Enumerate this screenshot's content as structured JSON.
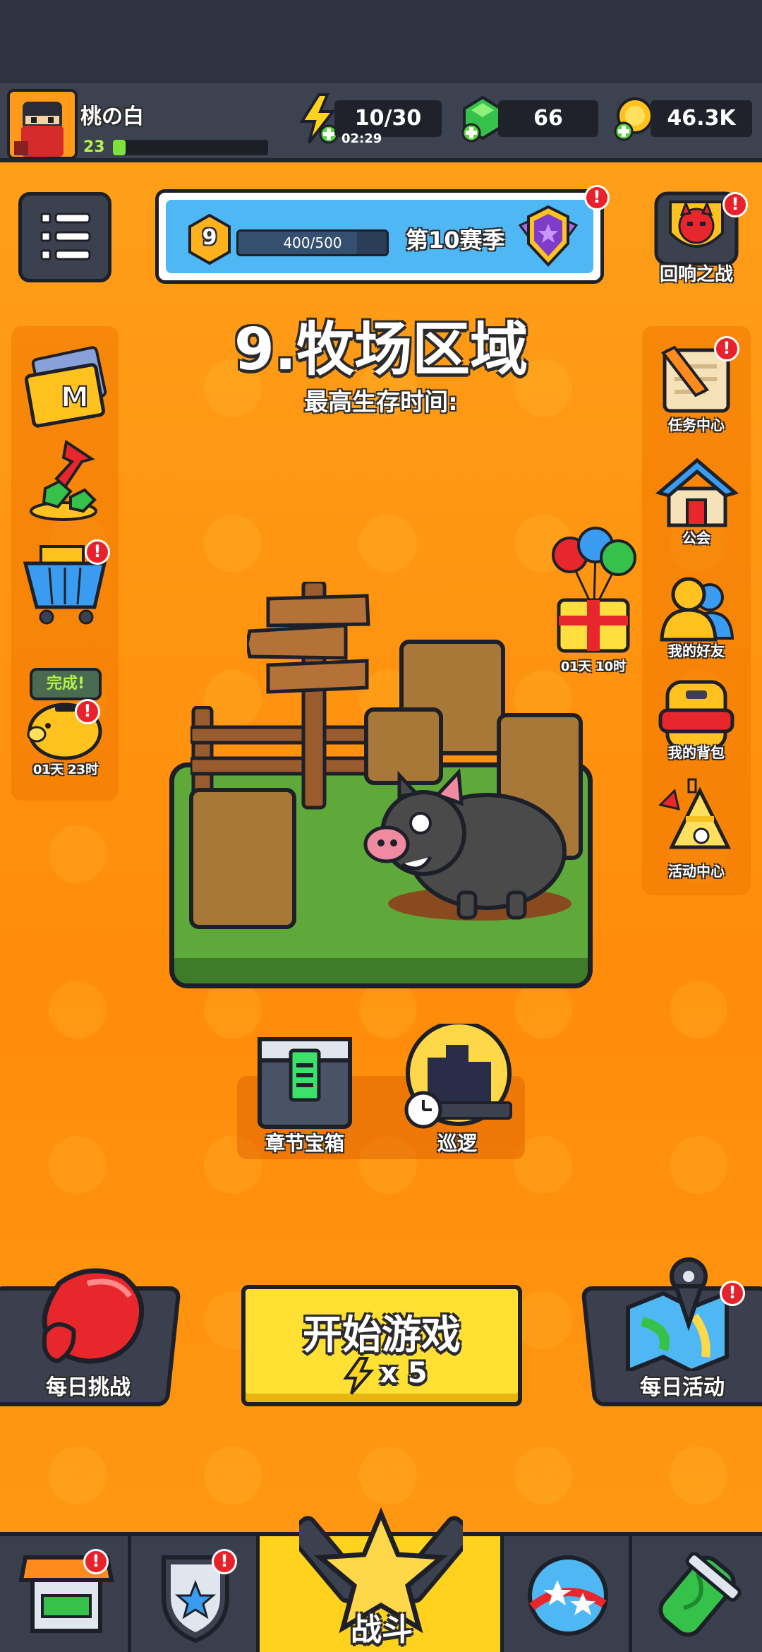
{
  "player": {
    "name": "桃の白",
    "level": "23",
    "xp_fraction": 0.08
  },
  "resources": {
    "energy": {
      "value": "10/30",
      "timer": "02:29"
    },
    "gems": {
      "value": "66"
    },
    "coins": {
      "value": "46.3K"
    }
  },
  "season": {
    "rank": "9",
    "progress": "400/500",
    "progress_fraction": 0.8,
    "label": "第10赛季"
  },
  "top_right": {
    "label": "回响之战"
  },
  "chapter": {
    "title": "9.牧场区域",
    "survive_label": "最高生存时间:"
  },
  "left_side": {
    "piggy_bubble": "完成!",
    "piggy_timer": "01天 23时"
  },
  "gift": {
    "timer": "01天 10时"
  },
  "right_side": {
    "items": [
      {
        "label": "任务中心"
      },
      {
        "label": "公会"
      },
      {
        "label": "我的好友"
      },
      {
        "label": "我的背包"
      },
      {
        "label": "活动中心"
      }
    ]
  },
  "chapter_actions": {
    "chest_label": "章节宝箱",
    "patrol_label": "巡逻"
  },
  "bottom": {
    "daily_challenge": "每日挑战",
    "start_label": "开始游戏",
    "start_cost": "x 5",
    "daily_event": "每日活动"
  },
  "nav": {
    "battle_label": "战斗"
  },
  "badge_mark": "!",
  "colors": {
    "background": "#ff9410",
    "accent": "#ffe033",
    "alert": "#e8222d"
  }
}
